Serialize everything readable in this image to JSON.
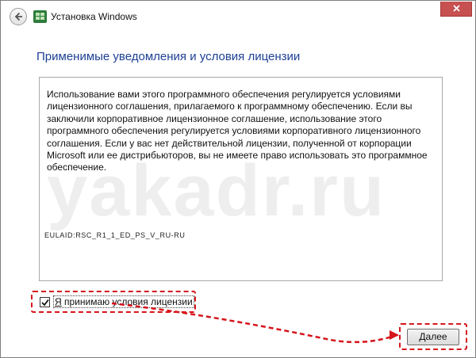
{
  "window": {
    "title": "Установка Windows"
  },
  "page": {
    "heading": "Применимые уведомления и условия лицензии"
  },
  "license": {
    "text": "Использование вами этого программного обеспечения регулируется условиями лицензионного соглашения, прилагаемого к программному обеспечению. Если вы заключили корпоративное лицензионное соглашение, использование этого программного обеспечения регулируется условиями корпоративного лицензионного соглашения. Если у вас нет действительной лицензии, полученной от корпорации Microsoft или ее дистрибьюторов, вы не имеете право использовать это программное обеспечение.",
    "eula_id": "EULAID:RSC_R1_1_ED_PS_V_RU-RU"
  },
  "watermark": "yakadr.ru",
  "accept": {
    "checked": true,
    "label_access_key": "Я",
    "label_rest": " принимаю условия лицензии"
  },
  "buttons": {
    "next_access_key": "Д",
    "next_rest": "алее"
  },
  "colors": {
    "heading": "#1c3f94",
    "highlight": "#d6141b",
    "close_button": "#c75050"
  }
}
